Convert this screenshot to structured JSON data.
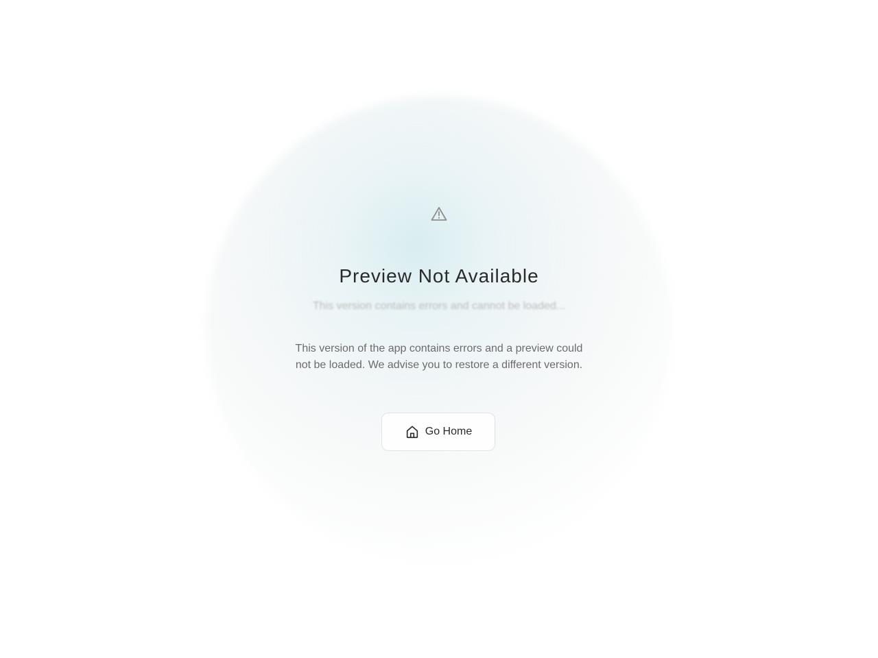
{
  "error": {
    "icon": "warning-triangle-icon",
    "title": "Preview Not Available",
    "subtitle": "This version contains errors and cannot be loaded...",
    "description": "This version of the app contains errors and a preview could not be loaded. We advise you to restore a different version."
  },
  "actions": {
    "home_label": "Go Home",
    "home_icon": "home-icon"
  },
  "colors": {
    "glow": "#d6ecf0",
    "title": "#2a2a2a",
    "description": "#6b6b6b"
  }
}
